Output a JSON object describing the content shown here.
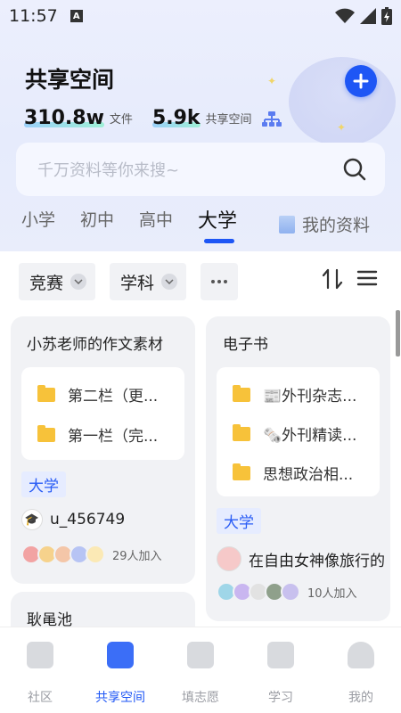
{
  "status": {
    "time": "11:57"
  },
  "header": {
    "title": "共享空间",
    "stats": [
      {
        "value": "310.8w",
        "label": "文件"
      },
      {
        "value": "5.9k",
        "label": "共享空间"
      }
    ]
  },
  "search": {
    "placeholder": "千万资料等你来搜~"
  },
  "tabs": [
    {
      "label": "小学"
    },
    {
      "label": "初中"
    },
    {
      "label": "高中"
    },
    {
      "label": "大学",
      "active": true
    }
  ],
  "my_docs": {
    "label": "我的资料"
  },
  "filters": [
    {
      "label": "竞赛"
    },
    {
      "label": "学科"
    }
  ],
  "cards": [
    {
      "title": "小苏老师的作文素材",
      "folders": [
        "第二栏（更...",
        "第一栏（完..."
      ],
      "tag": "大学",
      "owner": "u_456749",
      "members": "29人加入"
    },
    {
      "title": "电子书",
      "folders": [
        "📰外刊杂志...",
        "🗞️外刊精读...",
        "思想政治相..."
      ],
      "tag": "大学",
      "owner": "在自由女神像旅行的",
      "members": "10人加入"
    },
    {
      "title": "耿黾池"
    }
  ],
  "nav": [
    {
      "label": "社区"
    },
    {
      "label": "共享空间",
      "active": true
    },
    {
      "label": "填志愿"
    },
    {
      "label": "学习"
    },
    {
      "label": "我的"
    }
  ]
}
